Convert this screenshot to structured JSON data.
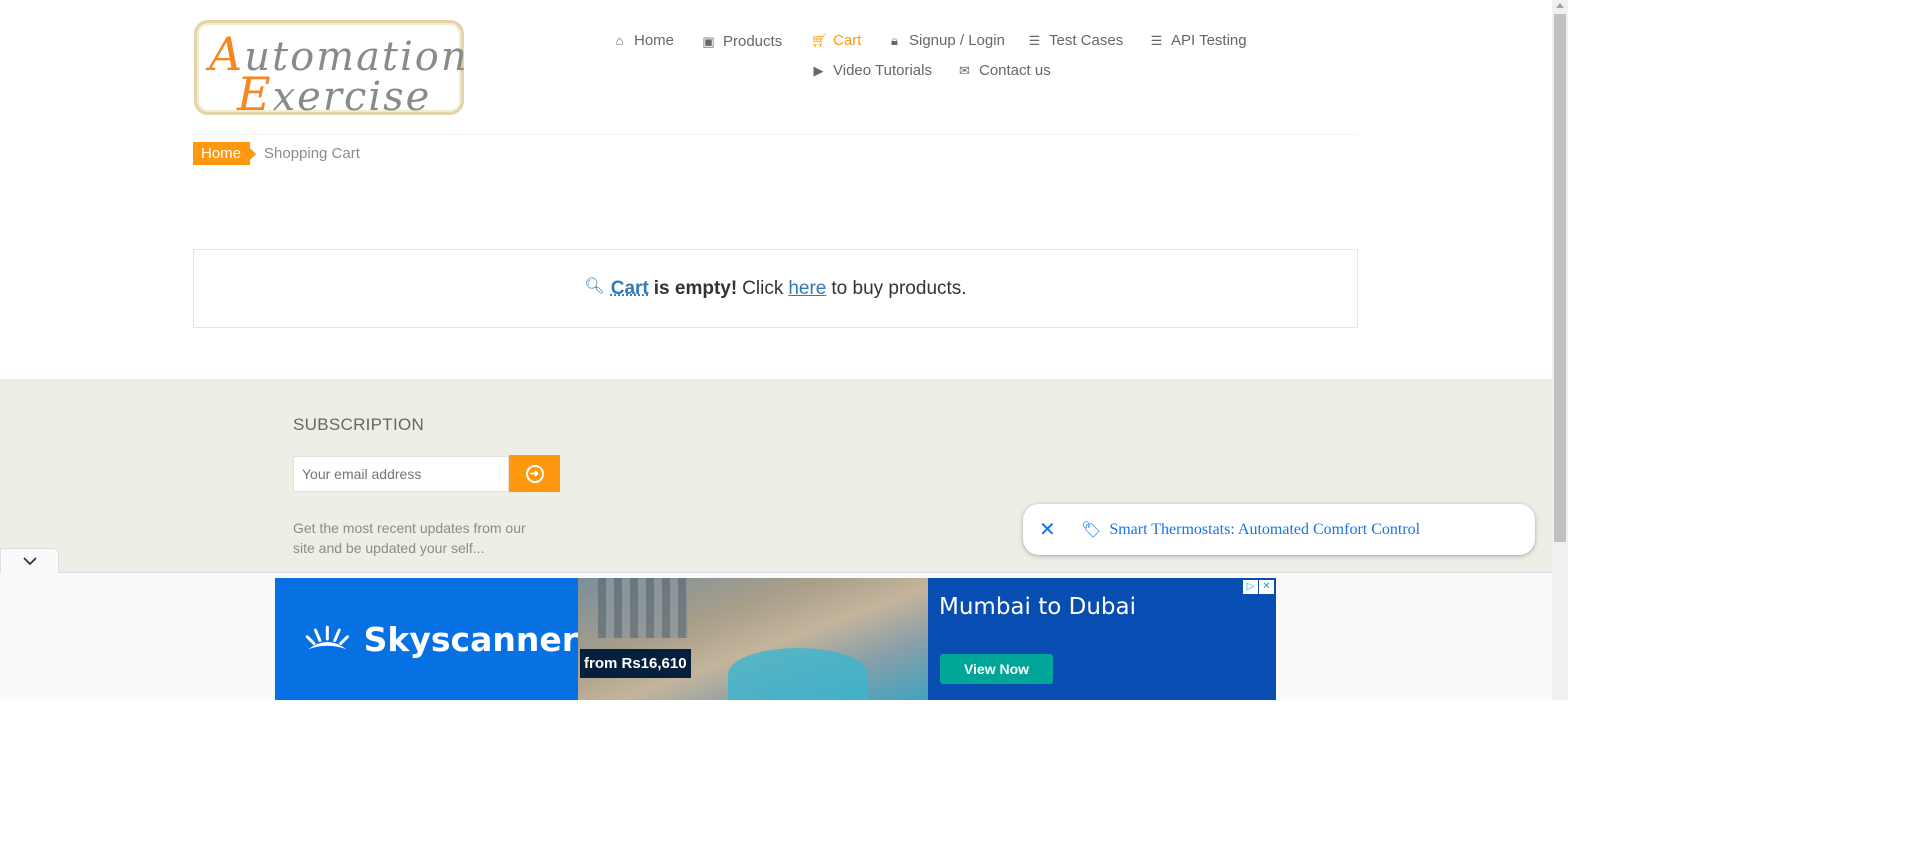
{
  "logo": {
    "line1_cap": "A",
    "line1_rest": "utomation",
    "line2_cap": "E",
    "line2_rest": "xercise"
  },
  "nav": [
    {
      "label": "Home",
      "icon": "home-icon"
    },
    {
      "label": "Products",
      "icon": "briefcase-icon"
    },
    {
      "label": "Cart",
      "icon": "cart-icon",
      "active": true
    },
    {
      "label": "Signup / Login",
      "icon": "lock-icon"
    },
    {
      "label": "Test Cases",
      "icon": "list-icon"
    },
    {
      "label": "API Testing",
      "icon": "list-icon"
    },
    {
      "label": "Video Tutorials",
      "icon": "youtube-play-icon"
    },
    {
      "label": "Contact us",
      "icon": "envelope-icon"
    }
  ],
  "breadcrumb": {
    "home": "Home",
    "current": "Shopping Cart"
  },
  "empty_cart": {
    "cart": "Cart",
    "is_empty": "is empty!",
    "click": "Click",
    "here": "here",
    "rest": "to buy products."
  },
  "footer": {
    "subscription_title": "SUBSCRIPTION",
    "email_placeholder": "Your email address",
    "description": "Get the most recent updates from our site and be updated your self..."
  },
  "related_search": {
    "text": "Smart Thermostats: Automated Comfort Control"
  },
  "ad": {
    "brand": "Skyscanner",
    "price": "from Rs16,610",
    "route": "Mumbai to Dubai",
    "cta": "View Now"
  },
  "colors": {
    "accent": "#fe980f",
    "link": "#337ab7",
    "footer_bg": "#eeede6",
    "ad_blue": "#0770e3",
    "ad_dark_blue": "#084eb2",
    "ad_cta": "#00a698"
  }
}
